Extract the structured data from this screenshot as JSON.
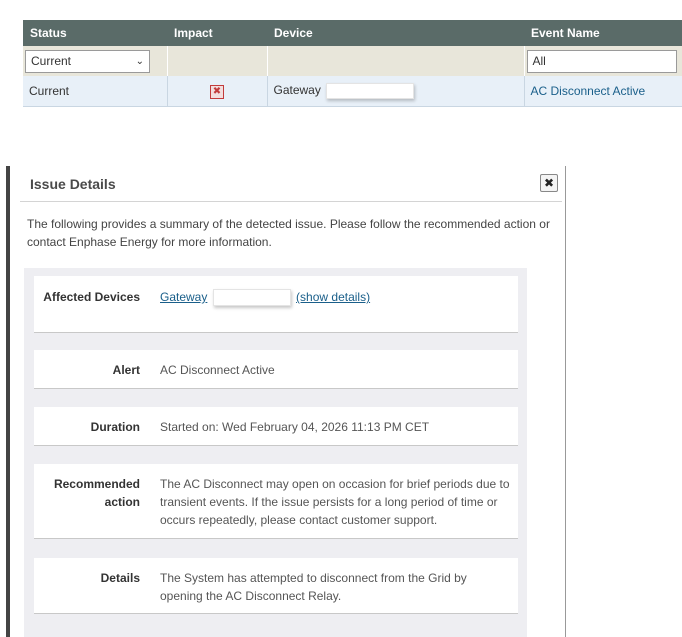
{
  "table": {
    "headers": [
      "Status",
      "Impact",
      "Device",
      "Event Name"
    ],
    "filters": {
      "status": "Current",
      "event_name": "All"
    },
    "row": {
      "status": "Current",
      "device": "Gateway",
      "event_name": "AC Disconnect Active"
    }
  },
  "dialog": {
    "title": "Issue Details",
    "intro": "The following provides a summary of the detected issue. Please follow the recommended action or contact Enphase Energy for more information.",
    "affected_devices": {
      "label": "Affected Devices",
      "device": "Gateway",
      "show_details": "(show details)"
    },
    "alert": {
      "label": "Alert",
      "value": "AC Disconnect Active"
    },
    "duration": {
      "label": "Duration",
      "value": "Started on: Wed February 04, 2026 11:13 PM CET"
    },
    "recommended_action": {
      "label": "Recommended action",
      "value": "The AC Disconnect may open on occasion for brief periods due to transient events. If the issue persists for a long period of time or occurs repeatedly, please contact customer support."
    },
    "details": {
      "label": "Details",
      "value": "The System has attempted to disconnect from the Grid by opening the AC Disconnect Relay."
    }
  },
  "colors": {
    "header_bg": "#5a6b68",
    "filter_bg": "#e8e6da",
    "row_bg": "#e8f0f8",
    "link": "#1a5f8a",
    "panel_bg": "#eeeef2",
    "impact_red": "#c23b3b"
  },
  "icons": {
    "impact": "error-x-icon",
    "close": "close-icon",
    "dropdown": "chevron-down-icon"
  }
}
